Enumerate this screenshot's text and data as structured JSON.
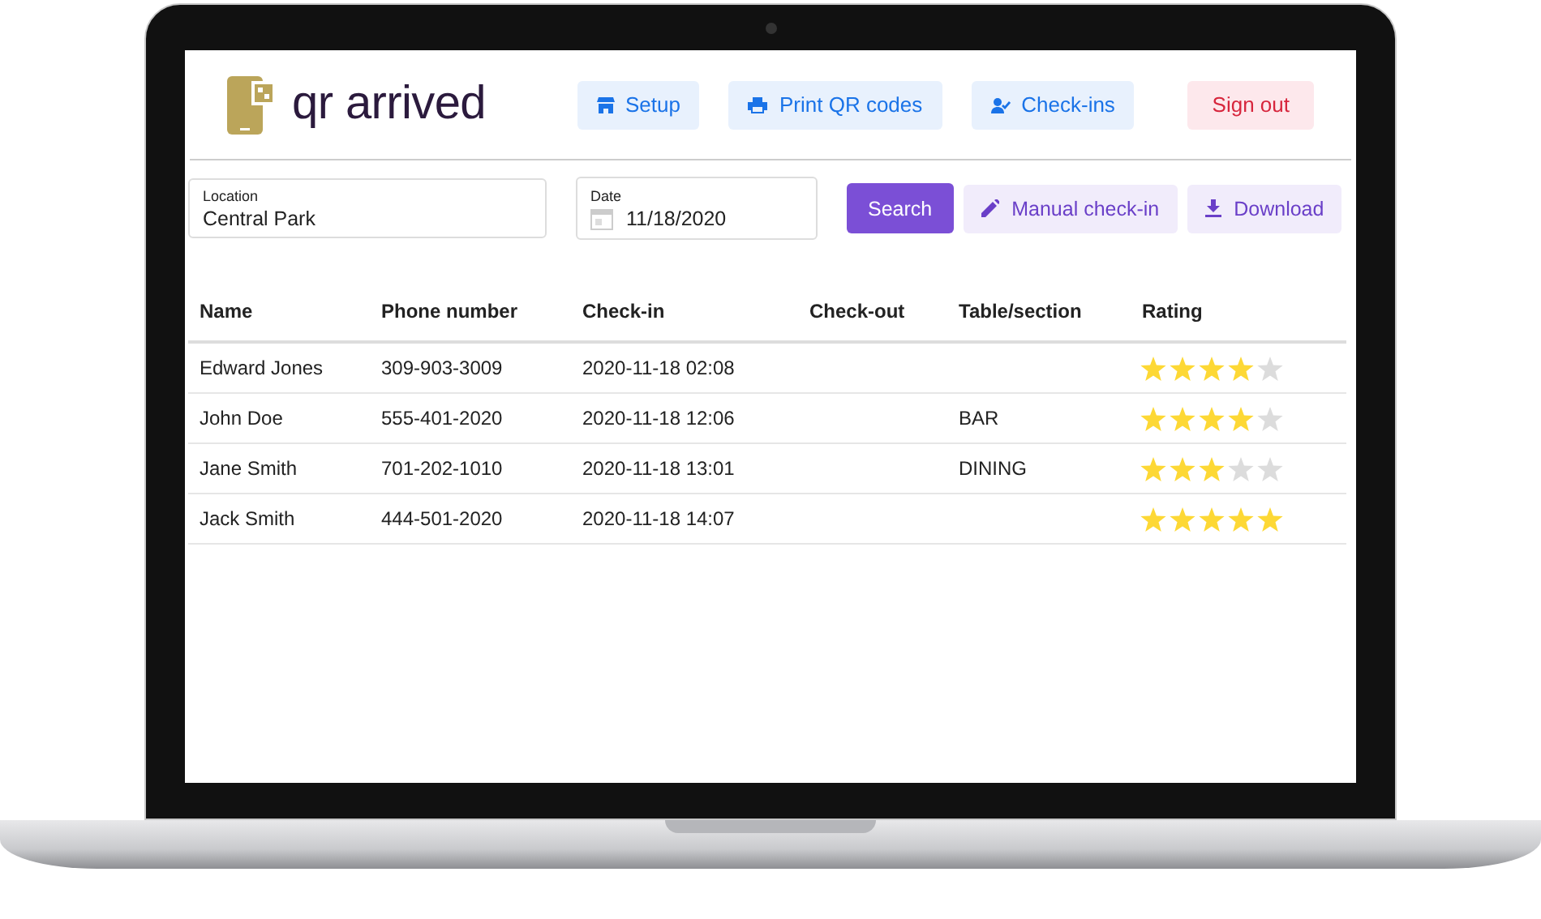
{
  "app": {
    "logo_text": "qr arrived"
  },
  "nav": [
    {
      "label": "Setup",
      "kind": "setup"
    },
    {
      "label": "Print QR codes",
      "kind": "print"
    },
    {
      "label": "Check-ins",
      "kind": "checkins"
    }
  ],
  "sign_out": "Sign out",
  "filters": {
    "location": {
      "label": "Location",
      "value": "Central Park"
    },
    "date": {
      "label": "Date",
      "value": "11/18/2020"
    },
    "search": "Search",
    "actions": [
      {
        "label": "Manual check-in",
        "kind": "edit"
      },
      {
        "label": "Download",
        "kind": "download"
      }
    ]
  },
  "table": {
    "columns": [
      "Name",
      "Phone number",
      "Check-in",
      "Check-out",
      "Table/section",
      "Rating"
    ],
    "rows": [
      {
        "name": "Edward Jones",
        "phone": "309-903-3009",
        "check_in": "2020-11-18 02:08",
        "stars": 4
      },
      {
        "name": "John Doe",
        "phone": "555-401-2020",
        "check_in": "2020-11-18 12:06",
        "table_section": "BAR",
        "stars": 4
      },
      {
        "name": "Jane Smith",
        "phone": "701-202-1010",
        "check_in": "2020-11-18 13:01",
        "table_section": "DINING",
        "stars": 3
      },
      {
        "name": "Jack Smith",
        "phone": "444-501-2020",
        "check_in": "2020-11-18 14:07",
        "stars": 5
      }
    ]
  }
}
